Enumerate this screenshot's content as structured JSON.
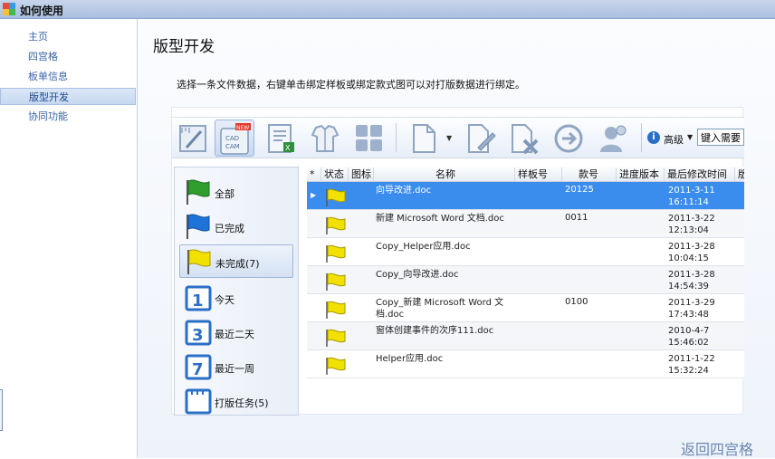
{
  "window": {
    "title": "如何使用"
  },
  "sidebar": {
    "items": [
      {
        "label": "主页",
        "active": false
      },
      {
        "label": "四宫格",
        "active": false
      },
      {
        "label": "板单信息",
        "active": false
      },
      {
        "label": "版型开发",
        "active": true
      },
      {
        "label": "协同功能",
        "active": false
      }
    ]
  },
  "main": {
    "title": "版型开发",
    "instruction": "选择一条文件数据，右键单击绑定样板或绑定款式图可以对打版数据进行绑定。",
    "back_link": "返回四宫格"
  },
  "toolbar": {
    "buttons": [
      {
        "icon": "ruler-pencil-icon"
      },
      {
        "icon": "cad-cam-icon",
        "badge": "NEW",
        "text": "CAD CAM"
      },
      {
        "icon": "excel-export-icon"
      },
      {
        "icon": "garment-icon"
      },
      {
        "icon": "grid-view-icon"
      },
      {
        "icon": "new-document-icon"
      },
      {
        "icon": "edit-document-icon"
      },
      {
        "icon": "delete-document-icon"
      },
      {
        "icon": "forward-arrow-icon"
      },
      {
        "icon": "user-stamp-icon"
      }
    ],
    "advanced_label": "高级",
    "search_value": "键入需要"
  },
  "filters": [
    {
      "label": "全部",
      "icon": "green-flag-icon",
      "active": false
    },
    {
      "label": "已完成",
      "icon": "blue-flag-icon",
      "active": false
    },
    {
      "label": "未完成(7)",
      "icon": "yellow-flag-icon",
      "active": true
    },
    {
      "label": "今天",
      "icon": "calendar-1-icon",
      "number": "1",
      "active": false
    },
    {
      "label": "最近二天",
      "icon": "calendar-3-icon",
      "number": "3",
      "active": false
    },
    {
      "label": "最近一周",
      "icon": "calendar-7-icon",
      "number": "7",
      "active": false
    },
    {
      "label": "打版任务(5)",
      "icon": "task-calendar-icon",
      "active": false
    }
  ],
  "grid": {
    "columns": [
      "*",
      "状态",
      "图标",
      "名称",
      "样板号",
      "款号",
      "进度版本",
      "最后修改时间",
      "版"
    ],
    "rows": [
      {
        "name": "向导改进.doc",
        "template_no": "",
        "style_no": "20125",
        "modified": "2011-3-11\n16:11:14",
        "selected": true
      },
      {
        "name": "新建 Microsoft Word 文档.doc",
        "template_no": "",
        "style_no": "0011",
        "modified": "2011-3-22\n12:13:04",
        "selected": false
      },
      {
        "name": "Copy_Helper应用.doc",
        "template_no": "",
        "style_no": "",
        "modified": "2011-3-28\n10:04:15",
        "selected": false
      },
      {
        "name": "Copy_向导改进.doc",
        "template_no": "",
        "style_no": "",
        "modified": "2011-3-28\n14:54:39",
        "selected": false
      },
      {
        "name": "Copy_新建 Microsoft Word 文档.doc",
        "template_no": "",
        "style_no": "0100",
        "modified": "2011-3-29\n17:43:48",
        "selected": false
      },
      {
        "name": "窗体创建事件的次序111.doc",
        "template_no": "",
        "style_no": "",
        "modified": "2010-4-7\n15:46:02",
        "selected": false
      },
      {
        "name": "Helper应用.doc",
        "template_no": "",
        "style_no": "",
        "modified": "2011-1-22\n15:32:24",
        "selected": false
      }
    ]
  },
  "colors": {
    "accent": "#3b8ded",
    "flag_yellow": "#f2e000",
    "flag_green": "#2f9e2f",
    "flag_blue": "#1e73d8",
    "link": "#6a86b3"
  }
}
